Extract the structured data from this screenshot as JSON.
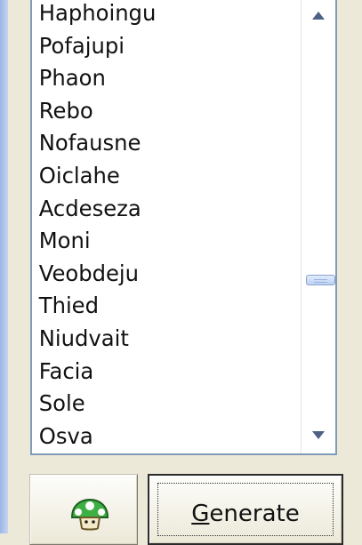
{
  "list": {
    "items": [
      "Haphoingu",
      "Pofajupi",
      "Phaon",
      "Rebo",
      "Nofausne",
      "Oiclahe",
      "Acdeseza",
      "Moni",
      "Veobdeju",
      "Thied",
      "Niudvait",
      "Facia",
      "Sole",
      "Osva"
    ]
  },
  "buttons": {
    "icon_button": {
      "icon": "green-mushroom-icon"
    },
    "generate": {
      "first_letter": "G",
      "rest": "enerate"
    }
  },
  "colors": {
    "list_border": "#7f9db9",
    "scroll_arrow": "#4d6185",
    "mushroom_green": "#3cb043"
  }
}
